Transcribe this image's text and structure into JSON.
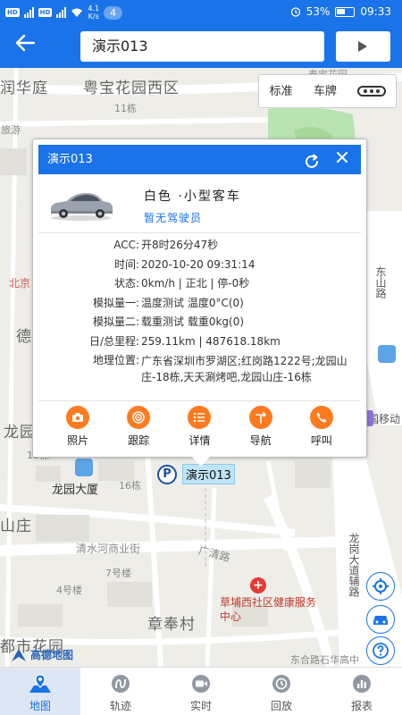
{
  "status_bar": {
    "network_speed_value": "4.1",
    "network_speed_unit": "K/s",
    "notification_count": "4",
    "battery": "53%",
    "time": "09:33"
  },
  "header": {
    "search_value": "演示013"
  },
  "map": {
    "map_type_buttons": [
      "标准",
      "车牌"
    ],
    "labels": {
      "runhuating": "润华庭",
      "yuebao": "粤宝花园西区",
      "lvyou": "旅游",
      "building11": "11栋",
      "beijing": "北京",
      "de": "德",
      "longyuan": "龙园",
      "building13": "13栋",
      "longyuandasha": "龙园大厦",
      "building16": "16栋",
      "shanzhuang": "山庄",
      "qingshuihe": "清水河商业街",
      "guangqing": "广清路",
      "building7": "7号楼",
      "building4": "4号楼",
      "zhangfengcun": "章奉村",
      "dushi": "都市花园",
      "caopu": "草埔西社区健康服务中心",
      "longgang": "龙岗大道辅路",
      "bamboo_partial": "东山路",
      "yidong": "国移动",
      "bottom_partial": "东合路石华高中",
      "top_partial": "泰宝花园"
    },
    "vehicle_label": "演示013",
    "vehicle_marker_letter": "P",
    "logo_text": "高德地图"
  },
  "popup": {
    "title": "演示013",
    "vehicle_type": "白色 ·小型客车",
    "driver": "暂无驾驶员",
    "rows": [
      {
        "key": "ACC",
        "value": "开8时26分47秒"
      },
      {
        "key": "时间",
        "value": "2020-10-20 09:31:14"
      },
      {
        "key": "状态",
        "value": "0km/h | 正北 | 停-0秒"
      },
      {
        "key": "模拟量一",
        "value": "温度测试 温度0°C(0)"
      },
      {
        "key": "模拟量二",
        "value": "载重测试 载重0kg(0)"
      },
      {
        "key": "日/总里程",
        "value": "259.11km | 487618.18km"
      },
      {
        "key": "地理位置",
        "value": "广东省深圳市罗湖区;红岗路1222号;龙园山庄-18栋,天天涮烤吧,龙园山庄-16栋"
      }
    ],
    "actions": [
      "照片",
      "跟踪",
      "详情",
      "导航",
      "呼叫"
    ]
  },
  "bottom_nav": [
    "地图",
    "轨迹",
    "实时",
    "回放",
    "报表"
  ],
  "colors": {
    "primary": "#1a73e8",
    "action_orange": "#ff7a1f",
    "map_bg": "#eeede8"
  }
}
